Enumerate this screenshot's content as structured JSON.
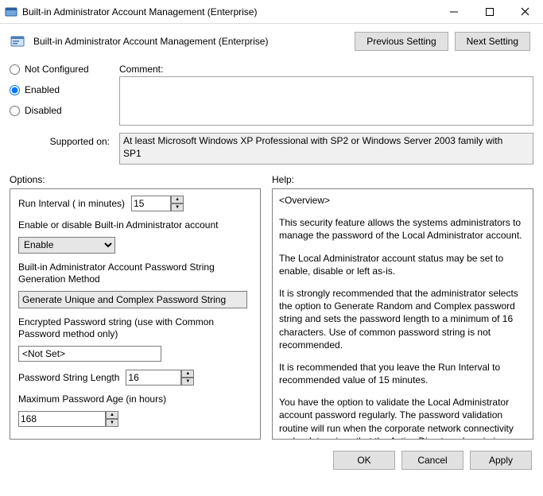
{
  "window": {
    "title": "Built-in Administrator Account Management (Enterprise)"
  },
  "header": {
    "title": "Built-in Administrator Account Management (Enterprise)",
    "prev_btn": "Previous Setting",
    "next_btn": "Next Setting"
  },
  "state": {
    "not_configured": "Not Configured",
    "enabled": "Enabled",
    "disabled": "Disabled",
    "selected": "enabled"
  },
  "labels": {
    "comment": "Comment:",
    "supported_on": "Supported on:",
    "options": "Options:",
    "help": "Help:"
  },
  "supported_text": "At least Microsoft Windows XP Professional with SP2 or Windows Server 2003 family with SP1",
  "options": {
    "run_interval_label": "Run Interval ( in minutes)",
    "run_interval_value": "15",
    "enable_disable_label": "Enable or disable Built-in Administrator account",
    "enable_disable_value": "Enable",
    "gen_method_label": "Built-in Administrator Account Password String Generation Method",
    "gen_method_value": "Generate Unique and Complex Password String",
    "encrypted_label": "Encrypted Password string (use with Common Password method only)",
    "encrypted_value": "<Not Set>",
    "pwd_len_label": "Password String Length",
    "pwd_len_value": "16",
    "max_age_label": "Maximum Password Age (in hours)",
    "max_age_value": "168"
  },
  "help": {
    "p0": "<Overview>",
    "p1": "This security feature allows the systems administrators to manage the password of the Local Administrator account.",
    "p2": "The Local Administrator account status may be set to enable, disable or left as-is.",
    "p3": "It is strongly recommended that the administrator selects the option to Generate Random and Complex password string and sets the password length to a minimum of 16 characters.  Use of common password string is not recommended.",
    "p4": "It is recommended that you leave the Run Interval to recommended value of 15 minutes.",
    "p5": "You have the option to validate the Local Administrator account password regularly.   The password validation routine will run when the corporate network connectivity probe determines that the Active Directory domain is accessible, either over a VPN connection or other methods i.e. LAN connected or WiFi"
  },
  "footer": {
    "ok": "OK",
    "cancel": "Cancel",
    "apply": "Apply"
  }
}
